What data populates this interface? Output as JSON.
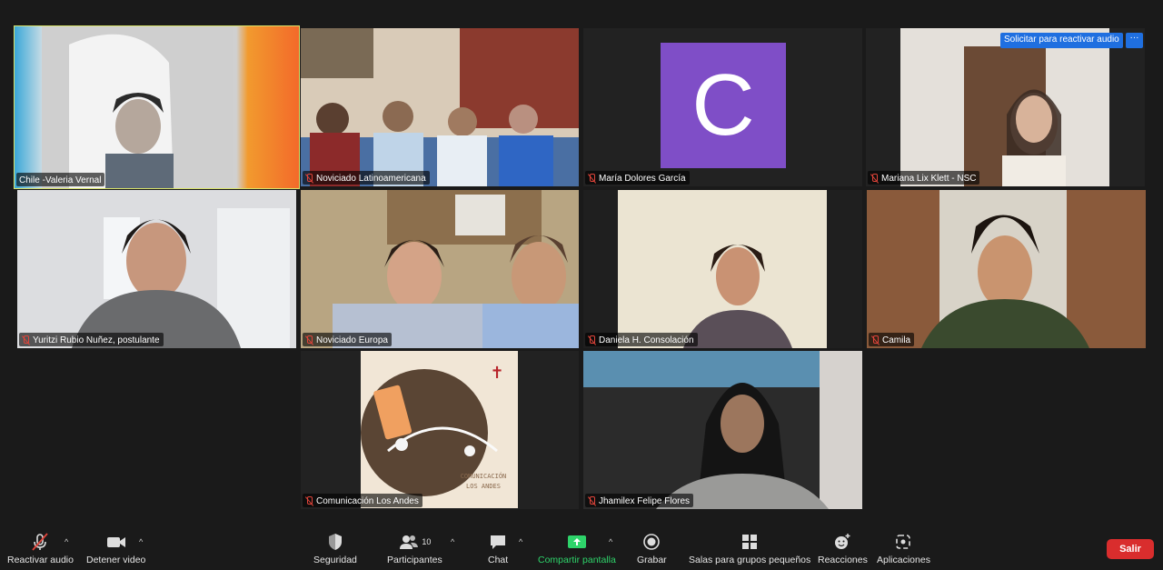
{
  "participants": [
    {
      "name": "Chile -Valeria Vernal",
      "muted": false
    },
    {
      "name": "Noviciado Latinoamericana",
      "muted": true
    },
    {
      "name": "María Dolores García",
      "muted": true,
      "avatar_letter": "C",
      "avatar_color": "#7f4ec7"
    },
    {
      "name": "Mariana Lix Klett - NSC",
      "muted": true
    },
    {
      "name": "Yuritzi Rubio Nuñez, postulante",
      "muted": true
    },
    {
      "name": "Noviciado Europa",
      "muted": true
    },
    {
      "name": "Daniela H. Consolación",
      "muted": true
    },
    {
      "name": "Camila",
      "muted": true
    },
    {
      "name": "Comunicación Los Andes",
      "muted": true
    },
    {
      "name": "Jhamilex Felipe Flores",
      "muted": true
    }
  ],
  "request_audio": {
    "label": "Solicitar para reactivar audio",
    "more": "···"
  },
  "toolbar": {
    "unmute": "Reactivar audio",
    "stop_video": "Detener video",
    "security": "Seguridad",
    "participants": "Participantes",
    "participants_count": "10",
    "chat": "Chat",
    "share": "Compartir pantalla",
    "record": "Grabar",
    "breakout": "Salas para grupos pequeños",
    "reactions": "Reacciones",
    "apps": "Aplicaciones",
    "leave": "Salir"
  },
  "colors": {
    "active_speaker": "#d9e36a",
    "share": "#2ed36a",
    "leave": "#d92d2d",
    "request_btn": "#1f6fe0"
  },
  "comunicacion_logo": {
    "line1": "COMUNICACIÓN",
    "line2": "LOS ANDES"
  }
}
